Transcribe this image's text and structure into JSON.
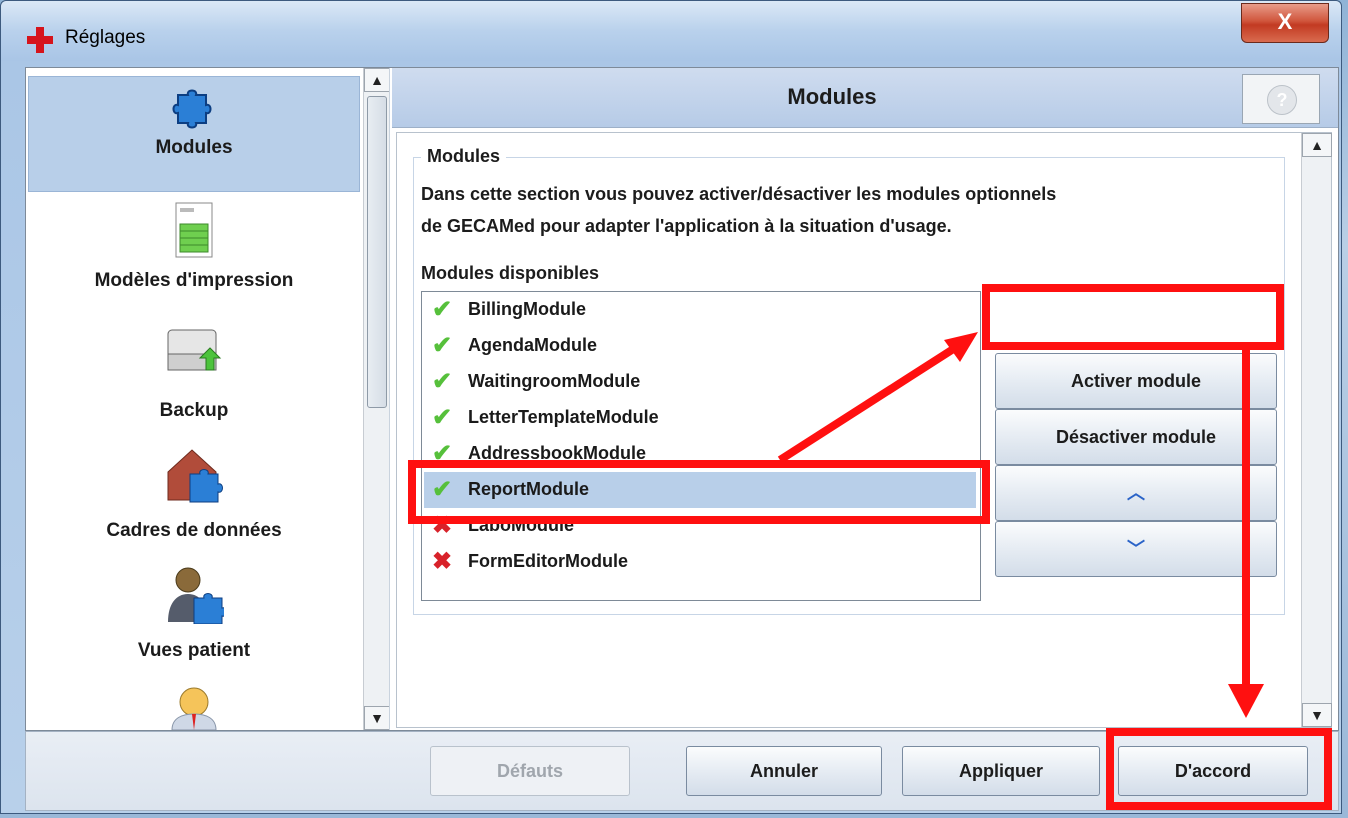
{
  "window": {
    "title": "Réglages",
    "close_label": "X"
  },
  "sidebar": {
    "items": [
      {
        "label": "Modules",
        "icon": "puzzle-icon",
        "selected": true
      },
      {
        "label": "Modèles d'impression",
        "icon": "document-icon",
        "selected": false
      },
      {
        "label": "Backup",
        "icon": "drive-backup-icon",
        "selected": false
      },
      {
        "label": "Cadres de données",
        "icon": "house-puzzle-icon",
        "selected": false
      },
      {
        "label": "Vues patient",
        "icon": "person-puzzle-icon",
        "selected": false
      },
      {
        "label": "",
        "icon": "user-icon",
        "selected": false
      }
    ]
  },
  "main": {
    "title": "Modules",
    "help_label": "?",
    "group_title": "Modules",
    "description_line1": "Dans cette section vous pouvez activer/désactiver les modules optionnels",
    "description_line2": "de GECAMed pour adapter l'application à la situation d'usage.",
    "available_label": "Modules disponibles",
    "modules": [
      {
        "name": "BillingModule",
        "enabled": true
      },
      {
        "name": "AgendaModule",
        "enabled": true
      },
      {
        "name": "WaitingroomModule",
        "enabled": true
      },
      {
        "name": "LetterTemplateModule",
        "enabled": true
      },
      {
        "name": "AddressbookModule",
        "enabled": true
      },
      {
        "name": "ReportModule",
        "enabled": true,
        "selected": true
      },
      {
        "name": "LaboModule",
        "enabled": false
      },
      {
        "name": "FormEditorModule",
        "enabled": false
      }
    ],
    "buttons": {
      "activate": "Activer module",
      "deactivate": "Désactiver module",
      "up": "︿",
      "down": "﹀"
    }
  },
  "footer": {
    "defaults": "Défauts",
    "cancel": "Annuler",
    "apply": "Appliquer",
    "ok": "D'accord"
  },
  "colors": {
    "highlight": "#ff1010",
    "selection": "#b8cfe9",
    "check": "#56c03b",
    "cross": "#d8222a"
  }
}
